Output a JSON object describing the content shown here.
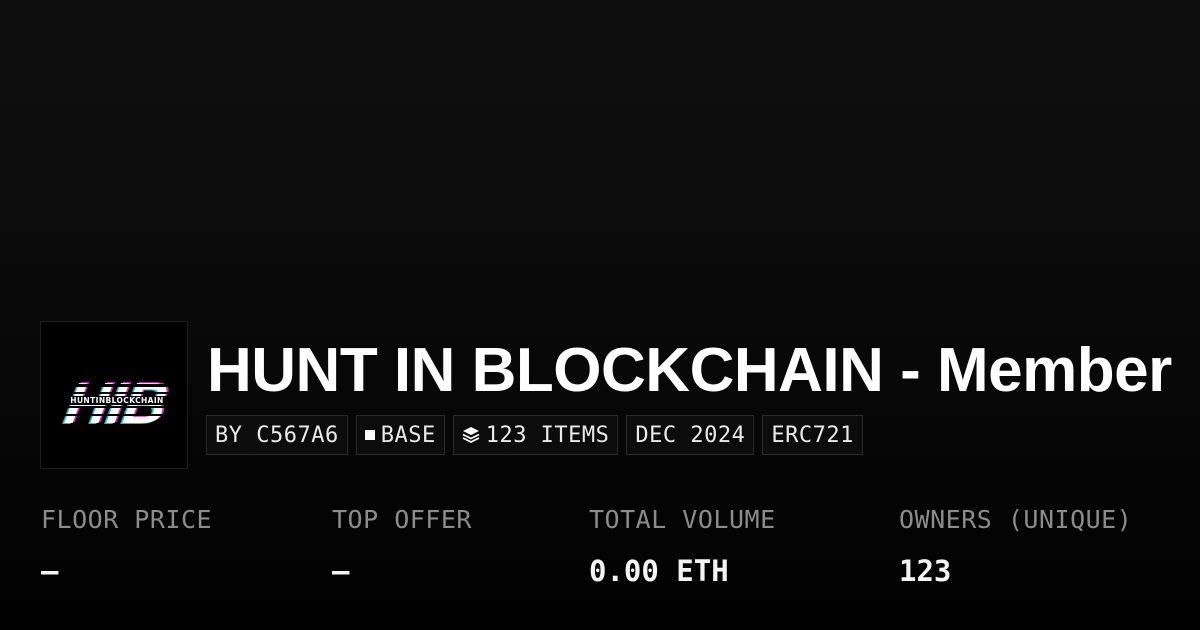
{
  "collection": {
    "title": "HUNT IN BLOCKCHAIN - Member",
    "logo_text": "HIB",
    "logo_subtext": "HUNTINBLOCKCHAIN",
    "badges": [
      {
        "label": "BY C567A6",
        "icon": ""
      },
      {
        "label": "BASE",
        "icon": "base-chain-square-icon"
      },
      {
        "label": "123 ITEMS",
        "icon": "layers-icon"
      },
      {
        "label": "DEC 2024",
        "icon": ""
      },
      {
        "label": "ERC721",
        "icon": ""
      }
    ]
  },
  "stats": [
    {
      "label": "FLOOR PRICE",
      "value": "—"
    },
    {
      "label": "TOP OFFER",
      "value": "—"
    },
    {
      "label": "TOTAL VOLUME",
      "value": "0.00 ETH"
    },
    {
      "label": "OWNERS (UNIQUE)",
      "value": "123"
    }
  ],
  "colors": {
    "background": "#000000",
    "text": "#ffffff",
    "muted": "#8c8c8c",
    "logo_cyan": "#29d8e8",
    "logo_magenta": "#e83ad0"
  }
}
